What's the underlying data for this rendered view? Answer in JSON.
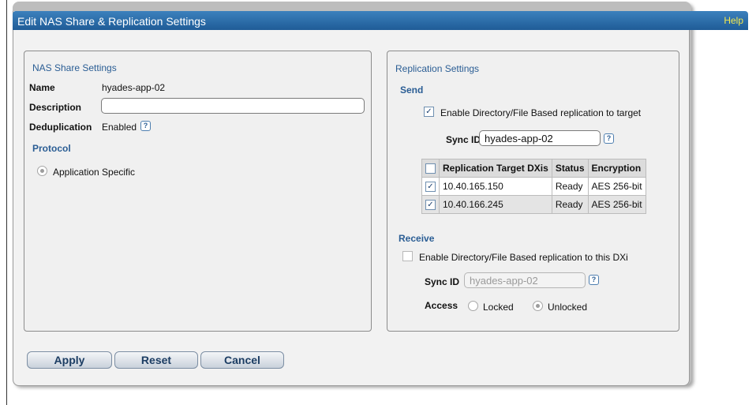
{
  "window": {
    "title": "Edit NAS Share & Replication Settings",
    "help": "Help"
  },
  "nas": {
    "legend": "NAS Share Settings",
    "name_label": "Name",
    "name_value": "hyades-app-02",
    "description_label": "Description",
    "description_value": "",
    "dedup_label": "Deduplication",
    "dedup_value": "Enabled",
    "protocol_label": "Protocol",
    "protocol_option": "Application Specific"
  },
  "replication": {
    "legend": "Replication Settings",
    "send": {
      "label": "Send",
      "enable_label": "Enable Directory/File Based replication to target",
      "enabled": true,
      "sync_id_label": "Sync ID",
      "sync_id_value": "hyades-app-02",
      "table": {
        "headers": [
          "Replication Target DXis",
          "Status",
          "Encryption"
        ],
        "rows": [
          {
            "target": "10.40.165.150",
            "status": "Ready",
            "encryption": "AES 256-bit",
            "checked": true
          },
          {
            "target": "10.40.166.245",
            "status": "Ready",
            "encryption": "AES 256-bit",
            "checked": true
          }
        ]
      }
    },
    "receive": {
      "label": "Receive",
      "enable_label": "Enable Directory/File Based replication to this DXi",
      "enabled": false,
      "sync_id_label": "Sync ID",
      "sync_id_value": "hyades-app-02",
      "access_label": "Access",
      "access_options": [
        "Locked",
        "Unlocked"
      ],
      "access_selected": "Unlocked"
    }
  },
  "buttons": {
    "apply": "Apply",
    "reset": "Reset",
    "cancel": "Cancel"
  },
  "icons": {
    "help": "?",
    "check": "✓"
  }
}
